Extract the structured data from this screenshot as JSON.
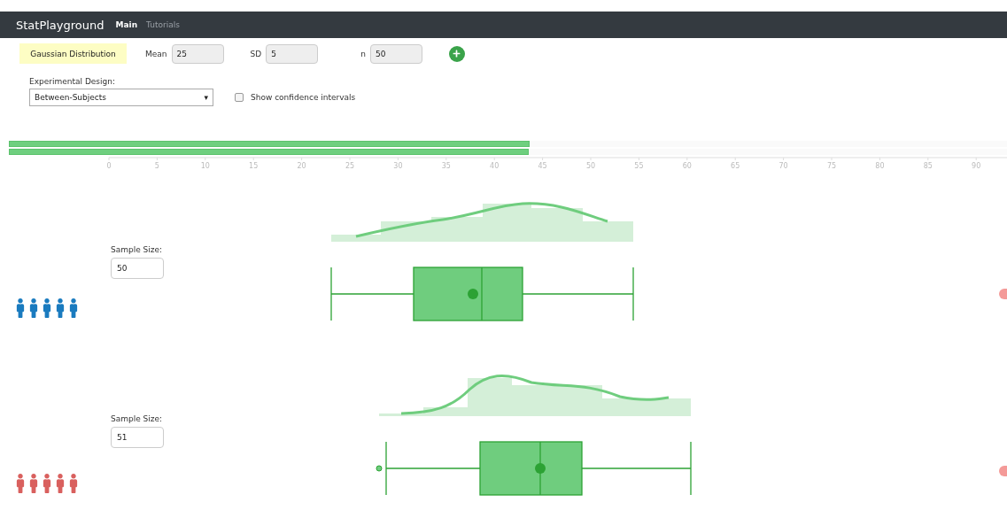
{
  "navbar": {
    "brand": "StatPlayground",
    "tabs": [
      {
        "label": "Main",
        "selected": true
      },
      {
        "label": "Tutorials",
        "selected": false
      }
    ]
  },
  "distribution": {
    "label": "Gaussian Distribution",
    "fields": [
      {
        "label": "Mean",
        "value": "25"
      },
      {
        "label": "SD",
        "value": "5"
      },
      {
        "label": "n",
        "value": "50"
      }
    ]
  },
  "design": {
    "label": "Experimental Design:",
    "value": "Between-Subjects",
    "caret": "▾"
  },
  "confidence_intervals": {
    "label": "Show confidence intervals",
    "checked": false
  },
  "summary_bars": [
    {
      "level": 0.522
    },
    {
      "level": 0.521
    }
  ],
  "axis_ticks": [
    "0",
    "5",
    "10",
    "15",
    "20",
    "25",
    "30",
    "35",
    "40",
    "45",
    "50",
    "55",
    "60",
    "65",
    "70",
    "75",
    "80",
    "85",
    "90"
  ],
  "groups": [
    {
      "sample_label": "Sample Size:",
      "sample_size": "50",
      "color": "#1a7bbf",
      "kind": "first"
    },
    {
      "sample_label": "Sample Size:",
      "sample_size": "51",
      "color": "#d9605e",
      "kind": "second"
    }
  ]
}
